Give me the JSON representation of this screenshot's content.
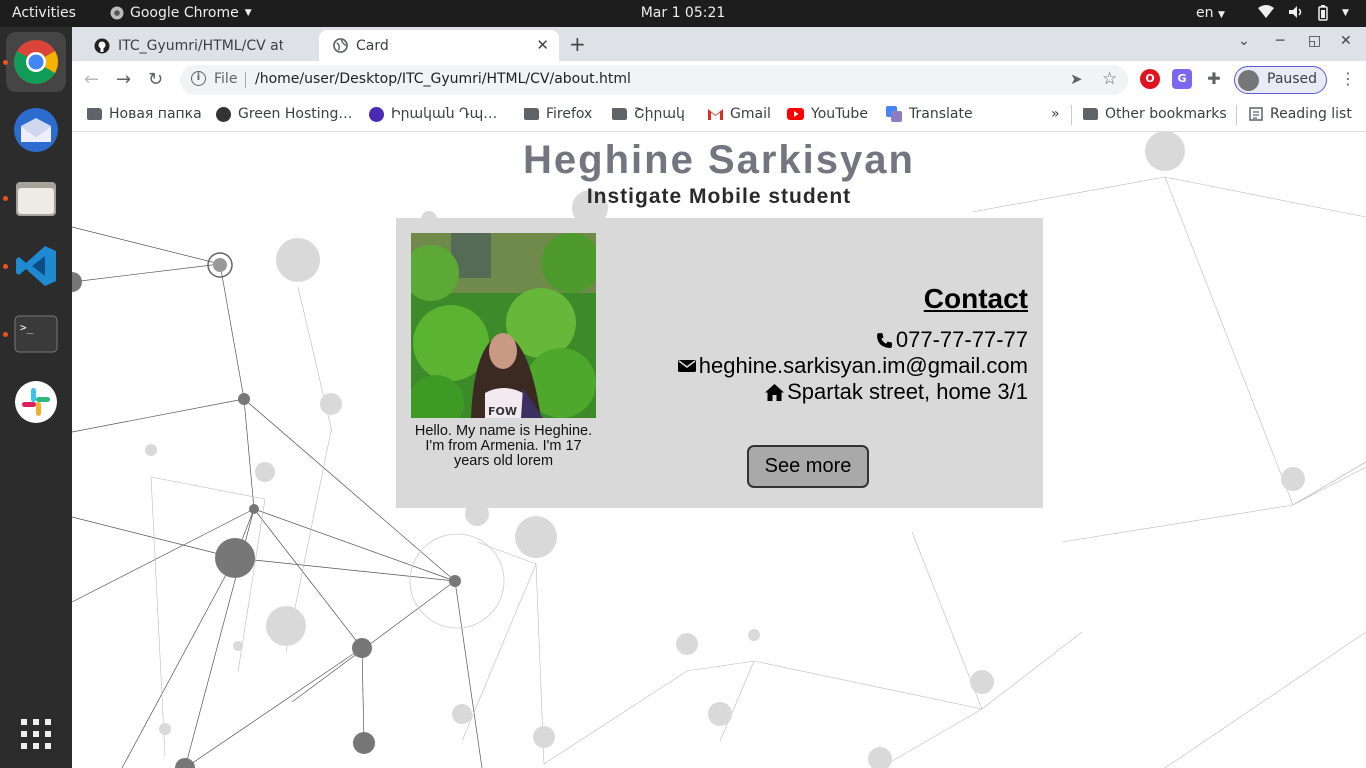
{
  "topbar": {
    "activities": "Activities",
    "app_name": "Google Chrome",
    "clock": "Mar 1  05:21",
    "language": "en"
  },
  "dock": {
    "apps": [
      "google-chrome",
      "thunderbird",
      "files",
      "visual-studio-code",
      "terminal",
      "slack",
      "show-applications"
    ]
  },
  "browser": {
    "tabs": [
      {
        "title": "ITC_Gyumri/HTML/CV at m",
        "icon": "github-icon",
        "active": false
      },
      {
        "title": "Card",
        "icon": "globe-icon",
        "active": true
      }
    ],
    "address": {
      "scheme_label": "File",
      "url": "/home/user/Desktop/ITC_Gyumri/HTML/CV/about.html"
    },
    "profile_label": "Paused",
    "bookmarks": [
      {
        "label": "Новая папка",
        "icon": "folder-icon"
      },
      {
        "label": "Green Hosting…",
        "icon": "globe-icon"
      },
      {
        "label": "Իրական Դպ…",
        "icon": "site-icon"
      },
      {
        "label": "Firefox",
        "icon": "folder-icon"
      },
      {
        "label": "Շիրակ",
        "icon": "folder-icon"
      },
      {
        "label": "Gmail",
        "icon": "gmail-icon"
      },
      {
        "label": "YouTube",
        "icon": "youtube-icon"
      },
      {
        "label": "Translate",
        "icon": "translate-icon"
      }
    ],
    "overflow_label": "»",
    "other_bookmarks": "Other bookmarks",
    "reading_list": "Reading list"
  },
  "page": {
    "name": "Heghine Sarkisyan",
    "role": "Instigate Mobile student",
    "intro_line1": "Hello. My name is Heghine.",
    "intro_line2": "I'm from Armenia. I'm 17 years old lorem",
    "contact_heading": "Contact",
    "phone": "077-77-77-77",
    "email": "heghine.sarkisyan.im@gmail.com",
    "address": "Spartak street, home 3/1",
    "button_label": "See more"
  },
  "colors": {
    "title": "#74767f",
    "card_bg": "#d9d9d9",
    "button_bg": "#a9a9a9",
    "topbar_bg": "#1d1d1d",
    "dock_bg": "#2c2c2c"
  }
}
